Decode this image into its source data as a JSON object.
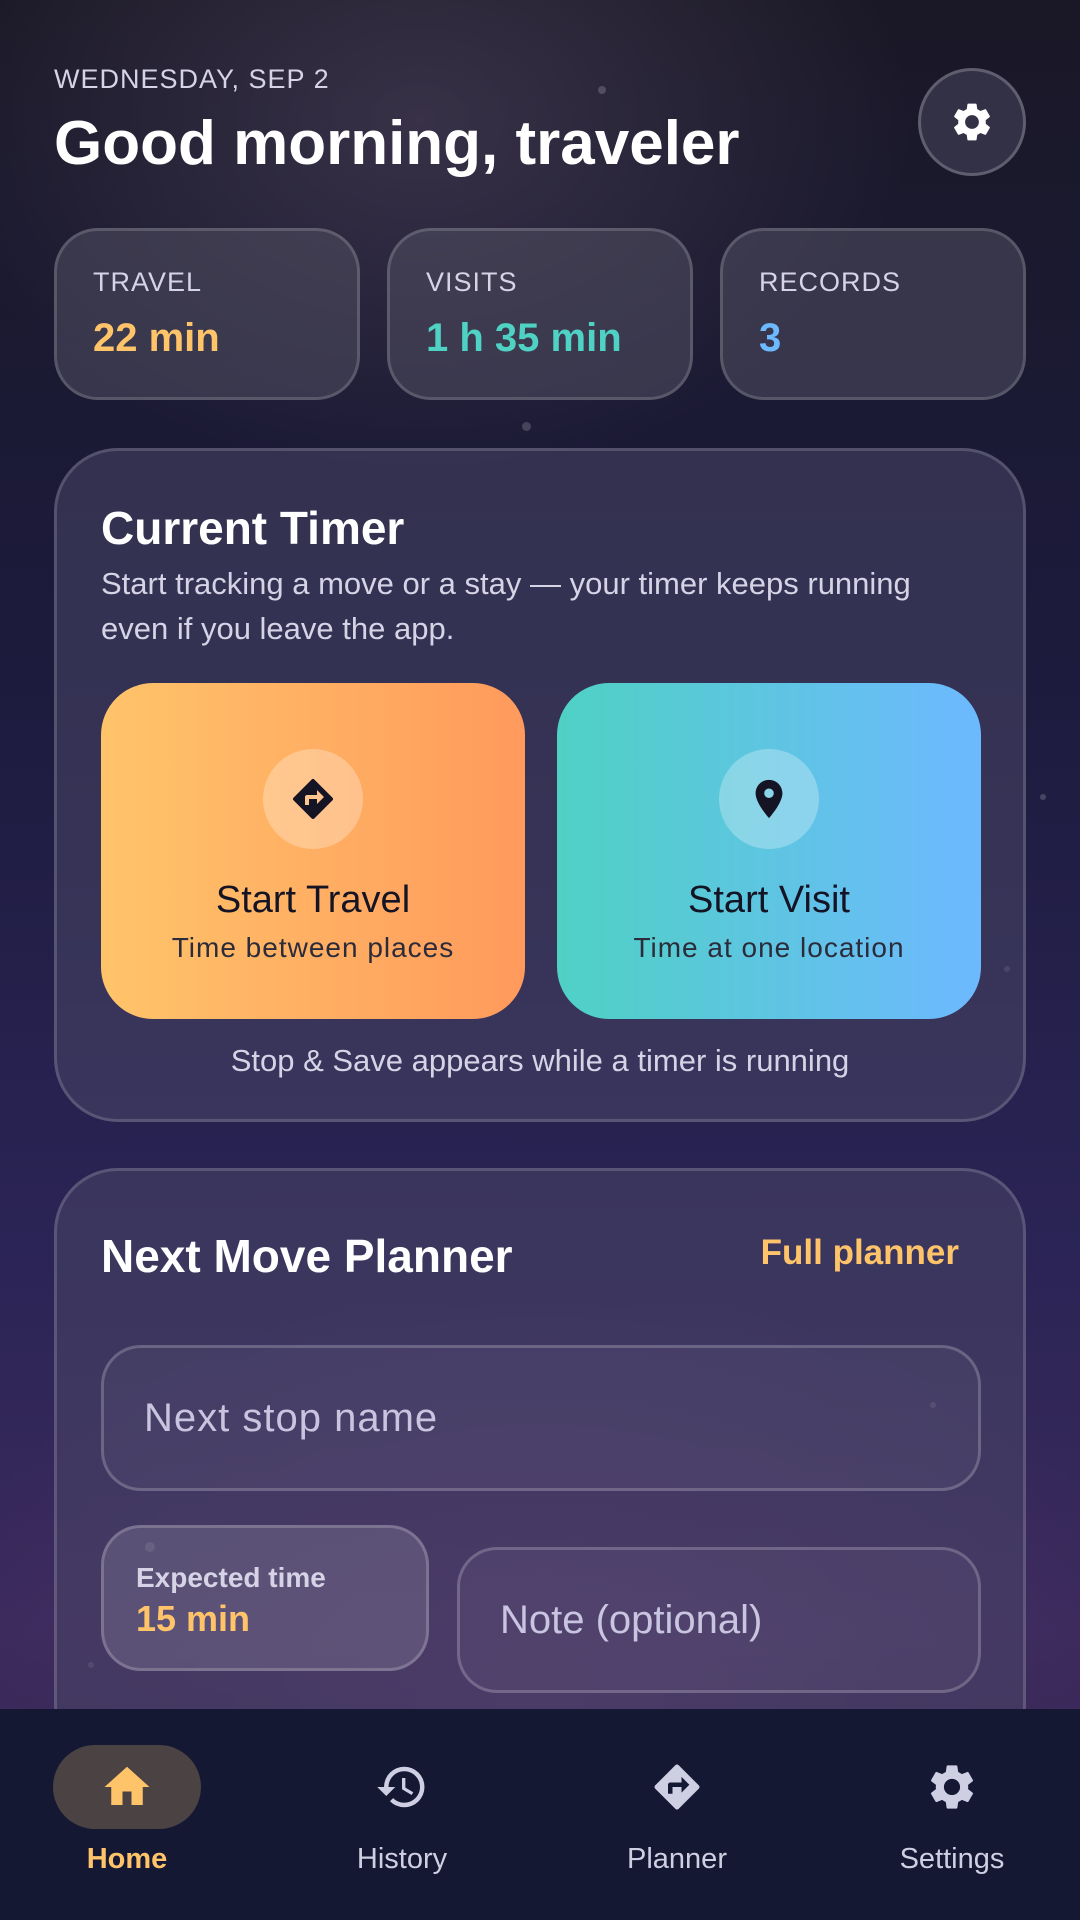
{
  "header": {
    "date": "WEDNESDAY, SEP 2",
    "greeting": "Good morning, traveler"
  },
  "stats": [
    {
      "label": "TRAVEL",
      "value": "22 min",
      "color": "#ffc46a"
    },
    {
      "label": "VISITS",
      "value": "1 h 35 min",
      "color": "#4fd1c4"
    },
    {
      "label": "RECORDS",
      "value": "3",
      "color": "#6db9ff"
    }
  ],
  "timer": {
    "title": "Current Timer",
    "description": "Start tracking a move or a stay — your timer keeps running even if you leave the app.",
    "travel": {
      "title": "Start Travel",
      "subtitle": "Time between places",
      "icon": "directions-icon"
    },
    "visit": {
      "title": "Start Visit",
      "subtitle": "Time at one location",
      "icon": "location-pin-icon"
    },
    "note": "Stop & Save appears while a timer is running"
  },
  "planner": {
    "title": "Next Move Planner",
    "link": "Full planner",
    "stop_placeholder": "Next stop name",
    "expected_label": "Expected time",
    "expected_value": "15 min",
    "note_placeholder": "Note (optional)"
  },
  "nav": [
    {
      "label": "Home",
      "icon": "home-icon",
      "active": true
    },
    {
      "label": "History",
      "icon": "history-icon",
      "active": false
    },
    {
      "label": "Planner",
      "icon": "directions-icon",
      "active": false
    },
    {
      "label": "Settings",
      "icon": "gear-icon",
      "active": false
    }
  ],
  "colors": {
    "accent_orange": "#ffc46a",
    "accent_teal": "#4fd1c4",
    "accent_blue": "#6db9ff"
  }
}
